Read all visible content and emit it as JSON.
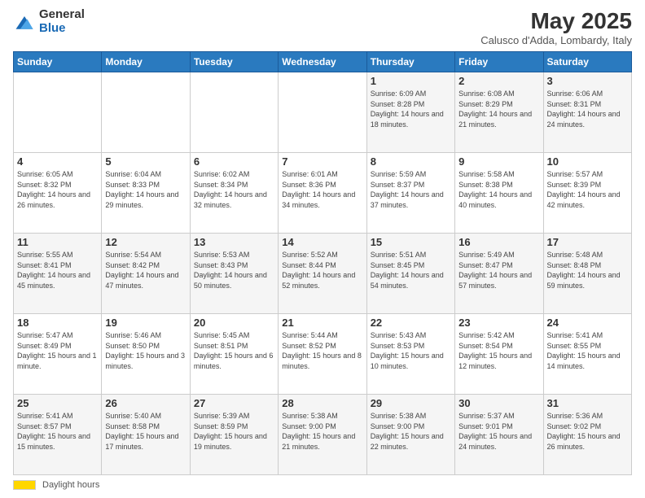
{
  "logo": {
    "general": "General",
    "blue": "Blue"
  },
  "title": "May 2025",
  "subtitle": "Calusco d'Adda, Lombardy, Italy",
  "days_of_week": [
    "Sunday",
    "Monday",
    "Tuesday",
    "Wednesday",
    "Thursday",
    "Friday",
    "Saturday"
  ],
  "weeks": [
    [
      {
        "day": "",
        "info": ""
      },
      {
        "day": "",
        "info": ""
      },
      {
        "day": "",
        "info": ""
      },
      {
        "day": "",
        "info": ""
      },
      {
        "day": "1",
        "info": "Sunrise: 6:09 AM\nSunset: 8:28 PM\nDaylight: 14 hours and 18 minutes."
      },
      {
        "day": "2",
        "info": "Sunrise: 6:08 AM\nSunset: 8:29 PM\nDaylight: 14 hours and 21 minutes."
      },
      {
        "day": "3",
        "info": "Sunrise: 6:06 AM\nSunset: 8:31 PM\nDaylight: 14 hours and 24 minutes."
      }
    ],
    [
      {
        "day": "4",
        "info": "Sunrise: 6:05 AM\nSunset: 8:32 PM\nDaylight: 14 hours and 26 minutes."
      },
      {
        "day": "5",
        "info": "Sunrise: 6:04 AM\nSunset: 8:33 PM\nDaylight: 14 hours and 29 minutes."
      },
      {
        "day": "6",
        "info": "Sunrise: 6:02 AM\nSunset: 8:34 PM\nDaylight: 14 hours and 32 minutes."
      },
      {
        "day": "7",
        "info": "Sunrise: 6:01 AM\nSunset: 8:36 PM\nDaylight: 14 hours and 34 minutes."
      },
      {
        "day": "8",
        "info": "Sunrise: 5:59 AM\nSunset: 8:37 PM\nDaylight: 14 hours and 37 minutes."
      },
      {
        "day": "9",
        "info": "Sunrise: 5:58 AM\nSunset: 8:38 PM\nDaylight: 14 hours and 40 minutes."
      },
      {
        "day": "10",
        "info": "Sunrise: 5:57 AM\nSunset: 8:39 PM\nDaylight: 14 hours and 42 minutes."
      }
    ],
    [
      {
        "day": "11",
        "info": "Sunrise: 5:55 AM\nSunset: 8:41 PM\nDaylight: 14 hours and 45 minutes."
      },
      {
        "day": "12",
        "info": "Sunrise: 5:54 AM\nSunset: 8:42 PM\nDaylight: 14 hours and 47 minutes."
      },
      {
        "day": "13",
        "info": "Sunrise: 5:53 AM\nSunset: 8:43 PM\nDaylight: 14 hours and 50 minutes."
      },
      {
        "day": "14",
        "info": "Sunrise: 5:52 AM\nSunset: 8:44 PM\nDaylight: 14 hours and 52 minutes."
      },
      {
        "day": "15",
        "info": "Sunrise: 5:51 AM\nSunset: 8:45 PM\nDaylight: 14 hours and 54 minutes."
      },
      {
        "day": "16",
        "info": "Sunrise: 5:49 AM\nSunset: 8:47 PM\nDaylight: 14 hours and 57 minutes."
      },
      {
        "day": "17",
        "info": "Sunrise: 5:48 AM\nSunset: 8:48 PM\nDaylight: 14 hours and 59 minutes."
      }
    ],
    [
      {
        "day": "18",
        "info": "Sunrise: 5:47 AM\nSunset: 8:49 PM\nDaylight: 15 hours and 1 minute."
      },
      {
        "day": "19",
        "info": "Sunrise: 5:46 AM\nSunset: 8:50 PM\nDaylight: 15 hours and 3 minutes."
      },
      {
        "day": "20",
        "info": "Sunrise: 5:45 AM\nSunset: 8:51 PM\nDaylight: 15 hours and 6 minutes."
      },
      {
        "day": "21",
        "info": "Sunrise: 5:44 AM\nSunset: 8:52 PM\nDaylight: 15 hours and 8 minutes."
      },
      {
        "day": "22",
        "info": "Sunrise: 5:43 AM\nSunset: 8:53 PM\nDaylight: 15 hours and 10 minutes."
      },
      {
        "day": "23",
        "info": "Sunrise: 5:42 AM\nSunset: 8:54 PM\nDaylight: 15 hours and 12 minutes."
      },
      {
        "day": "24",
        "info": "Sunrise: 5:41 AM\nSunset: 8:55 PM\nDaylight: 15 hours and 14 minutes."
      }
    ],
    [
      {
        "day": "25",
        "info": "Sunrise: 5:41 AM\nSunset: 8:57 PM\nDaylight: 15 hours and 15 minutes."
      },
      {
        "day": "26",
        "info": "Sunrise: 5:40 AM\nSunset: 8:58 PM\nDaylight: 15 hours and 17 minutes."
      },
      {
        "day": "27",
        "info": "Sunrise: 5:39 AM\nSunset: 8:59 PM\nDaylight: 15 hours and 19 minutes."
      },
      {
        "day": "28",
        "info": "Sunrise: 5:38 AM\nSunset: 9:00 PM\nDaylight: 15 hours and 21 minutes."
      },
      {
        "day": "29",
        "info": "Sunrise: 5:38 AM\nSunset: 9:00 PM\nDaylight: 15 hours and 22 minutes."
      },
      {
        "day": "30",
        "info": "Sunrise: 5:37 AM\nSunset: 9:01 PM\nDaylight: 15 hours and 24 minutes."
      },
      {
        "day": "31",
        "info": "Sunrise: 5:36 AM\nSunset: 9:02 PM\nDaylight: 15 hours and 26 minutes."
      }
    ]
  ],
  "footer": {
    "daylight_label": "Daylight hours"
  }
}
